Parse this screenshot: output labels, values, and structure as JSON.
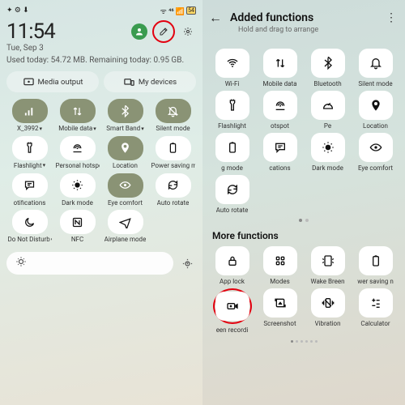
{
  "left": {
    "clock": "11:54",
    "date": "Tue, Sep 3",
    "usage": "Used today: 54.72 MB. Remaining today: 0.95 GB.",
    "pills": {
      "media": "Media output",
      "devices": "My devices"
    },
    "tiles": [
      {
        "id": "network",
        "label": "X_3992",
        "caret": true,
        "active": true,
        "icon": "signal"
      },
      {
        "id": "mobiledata",
        "label": "Mobile data",
        "caret": true,
        "active": true,
        "icon": "updown"
      },
      {
        "id": "smartband",
        "label": "Smart Band",
        "caret": true,
        "active": true,
        "icon": "bluetooth"
      },
      {
        "id": "silent",
        "label": "Silent mode",
        "active": true,
        "icon": "bell-off"
      },
      {
        "id": "flashlight",
        "label": "Flashlight",
        "caret": true,
        "icon": "flashlight"
      },
      {
        "id": "hotspot",
        "label": "Personal hotspot",
        "caret": true,
        "icon": "hotspot"
      },
      {
        "id": "location",
        "label": "Location",
        "icon": "location",
        "active": true
      },
      {
        "id": "powersave",
        "label": "Power saving mode",
        "icon": "battery"
      },
      {
        "id": "notifications",
        "label": "otifications",
        "icon": "comment"
      },
      {
        "id": "darkmode",
        "label": "Dark mode",
        "icon": "darkmode"
      },
      {
        "id": "eyecomfort",
        "label": "Eye comfort",
        "icon": "eye",
        "active": true
      },
      {
        "id": "autorotate",
        "label": "Auto rotate",
        "icon": "rotate"
      },
      {
        "id": "dnd",
        "label": "Do Not Disturb",
        "caret": true,
        "icon": "moon"
      },
      {
        "id": "nfc",
        "label": "NFC",
        "icon": "nfc"
      },
      {
        "id": "airplane",
        "label": "Airplane mode",
        "icon": "airplane"
      }
    ]
  },
  "right": {
    "title": "Added functions",
    "subtitle": "Hold and drag to arrange",
    "section2": "More functions",
    "tiles_top": [
      {
        "id": "wifi",
        "label": "Wi-Fi",
        "icon": "wifi"
      },
      {
        "id": "mobiledata",
        "label": "Mobile data",
        "icon": "updown"
      },
      {
        "id": "bluetooth",
        "label": "Bluetooth",
        "icon": "bluetooth"
      },
      {
        "id": "silent",
        "label": "Silent mode",
        "icon": "bell"
      },
      {
        "id": "flashlight",
        "label": "Flashlight",
        "icon": "flashlight"
      },
      {
        "id": "hotspot",
        "label": "otspot",
        "icon": "hotspot"
      },
      {
        "id": "perf",
        "label": "Pe",
        "icon": "speed"
      },
      {
        "id": "location",
        "label": "Location",
        "icon": "location"
      },
      {
        "id": "gmode",
        "label": "g mode",
        "icon": "battery"
      },
      {
        "id": "cations",
        "label": "cations",
        "icon": "comment"
      },
      {
        "id": "darkmode",
        "label": "Dark mode",
        "icon": "darkmode"
      },
      {
        "id": "eyecomfort",
        "label": "Eye comfort",
        "icon": "eye"
      },
      {
        "id": "autorotate",
        "label": "Auto rotate",
        "icon": "rotate"
      }
    ],
    "tiles_more": [
      {
        "id": "applock",
        "label": "App lock",
        "icon": "lock"
      },
      {
        "id": "modes",
        "label": "Modes",
        "icon": "grid"
      },
      {
        "id": "wakebreen",
        "label": "Wake Breen",
        "icon": "wake"
      },
      {
        "id": "wersaving",
        "label": "wer saving n",
        "icon": "battery"
      },
      {
        "id": "screenrec",
        "label": "een recordi",
        "icon": "record",
        "highlight": true
      },
      {
        "id": "screenshot",
        "label": "Screenshot",
        "icon": "screenshot"
      },
      {
        "id": "vibration",
        "label": "Vibration",
        "icon": "vibration"
      },
      {
        "id": "calculator",
        "label": "Calculator",
        "icon": "calculator"
      }
    ]
  }
}
